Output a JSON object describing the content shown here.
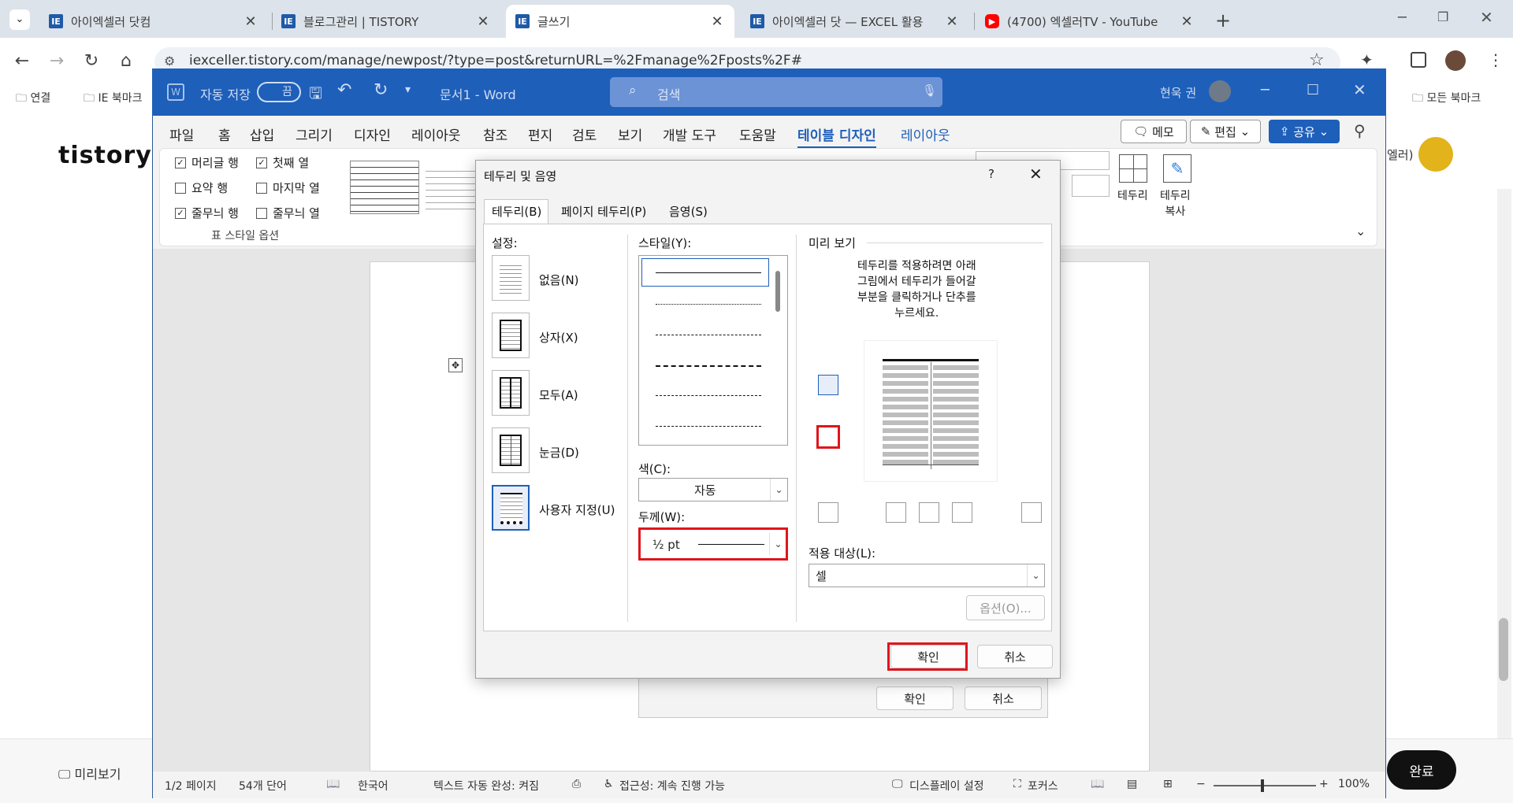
{
  "browser": {
    "tabs": [
      {
        "title": "아이엑셀러 닷컴",
        "icon": "ie-favicon"
      },
      {
        "title": "블로그관리 | TISTORY",
        "icon": "ie-favicon"
      },
      {
        "title": "글쓰기",
        "icon": "ie-favicon",
        "active": true
      },
      {
        "title": "아이엑셀러 닷 — EXCEL 활용 ",
        "icon": "ie-favicon"
      },
      {
        "title": "(4700) 엑셀러TV - YouTube",
        "icon": "youtube-favicon"
      }
    ],
    "url": "iexceller.tistory.com/manage/newpost/?type=post&returnURL=%2Fmanage%2Fposts%2F#",
    "bookmarks": {
      "item1": "연결",
      "item2": "IE 북마크",
      "all": "모든 북마크"
    }
  },
  "tistory": {
    "logo": "tistory",
    "preview_label": "미리보기",
    "done_label": "완료",
    "side_text": "엘러)"
  },
  "word": {
    "autosave_label": "자동 저장",
    "autosave_state": "끔",
    "doc_title": "문서1 - Word",
    "search_placeholder": "검색",
    "user": "현욱 권",
    "ribbon_tabs": [
      "파일",
      "홈",
      "삽입",
      "그리기",
      "디자인",
      "레이아웃",
      "참조",
      "편지",
      "검토",
      "보기",
      "개발 도구",
      "도움말",
      "테이블 디자인",
      "레이아웃"
    ],
    "active_tab_index": 12,
    "memo_label": "메모",
    "edit_label": "편집",
    "share_label": "공유",
    "style_options": {
      "header_row": "머리글 행",
      "first_col": "첫째 열",
      "total_row": "요약 행",
      "last_col": "마지막 열",
      "banded_rows": "줄무늬 행",
      "banded_cols": "줄무늬 열",
      "group_label": "표 스타일 옵션"
    },
    "borders_label": "테두리",
    "border_painter_label": "테두리\n복사",
    "status": {
      "page": "1/2 페이지",
      "words": "54개 단어",
      "language": "한국어",
      "autocomplete": "텍스트 자동 완성: 켜짐",
      "accessibility": "접근성: 계속 진행 가능",
      "display": "디스플레이 설정",
      "focus": "포커스",
      "zoom": "100%"
    }
  },
  "under_dialog": {
    "ok": "확인",
    "cancel": "취소"
  },
  "dialog": {
    "title": "테두리 및 음영",
    "help": "?",
    "tabs": [
      "테두리(B)",
      "페이지 테두리(P)",
      "음영(S)"
    ],
    "setting_label": "설정:",
    "settings": [
      "없음(N)",
      "상자(X)",
      "모두(A)",
      "눈금(D)",
      "사용자 지정(U)"
    ],
    "style_label": "스타일(Y):",
    "color_label": "색(C):",
    "color_value": "자동",
    "width_label": "두께(W):",
    "width_value": "½ pt",
    "preview_label": "미리 보기",
    "preview_help": "테두리를 적용하려면 아래\n그림에서 테두리가 들어갈\n부분을 클릭하거나 단추를\n누르세요.",
    "apply_label": "적용 대상(L):",
    "apply_value": "셀",
    "options_label": "옵션(O)...",
    "ok": "확인",
    "cancel": "취소"
  },
  "colors": {
    "word_blue": "#1e5fba",
    "highlight_red": "#e0151b"
  }
}
